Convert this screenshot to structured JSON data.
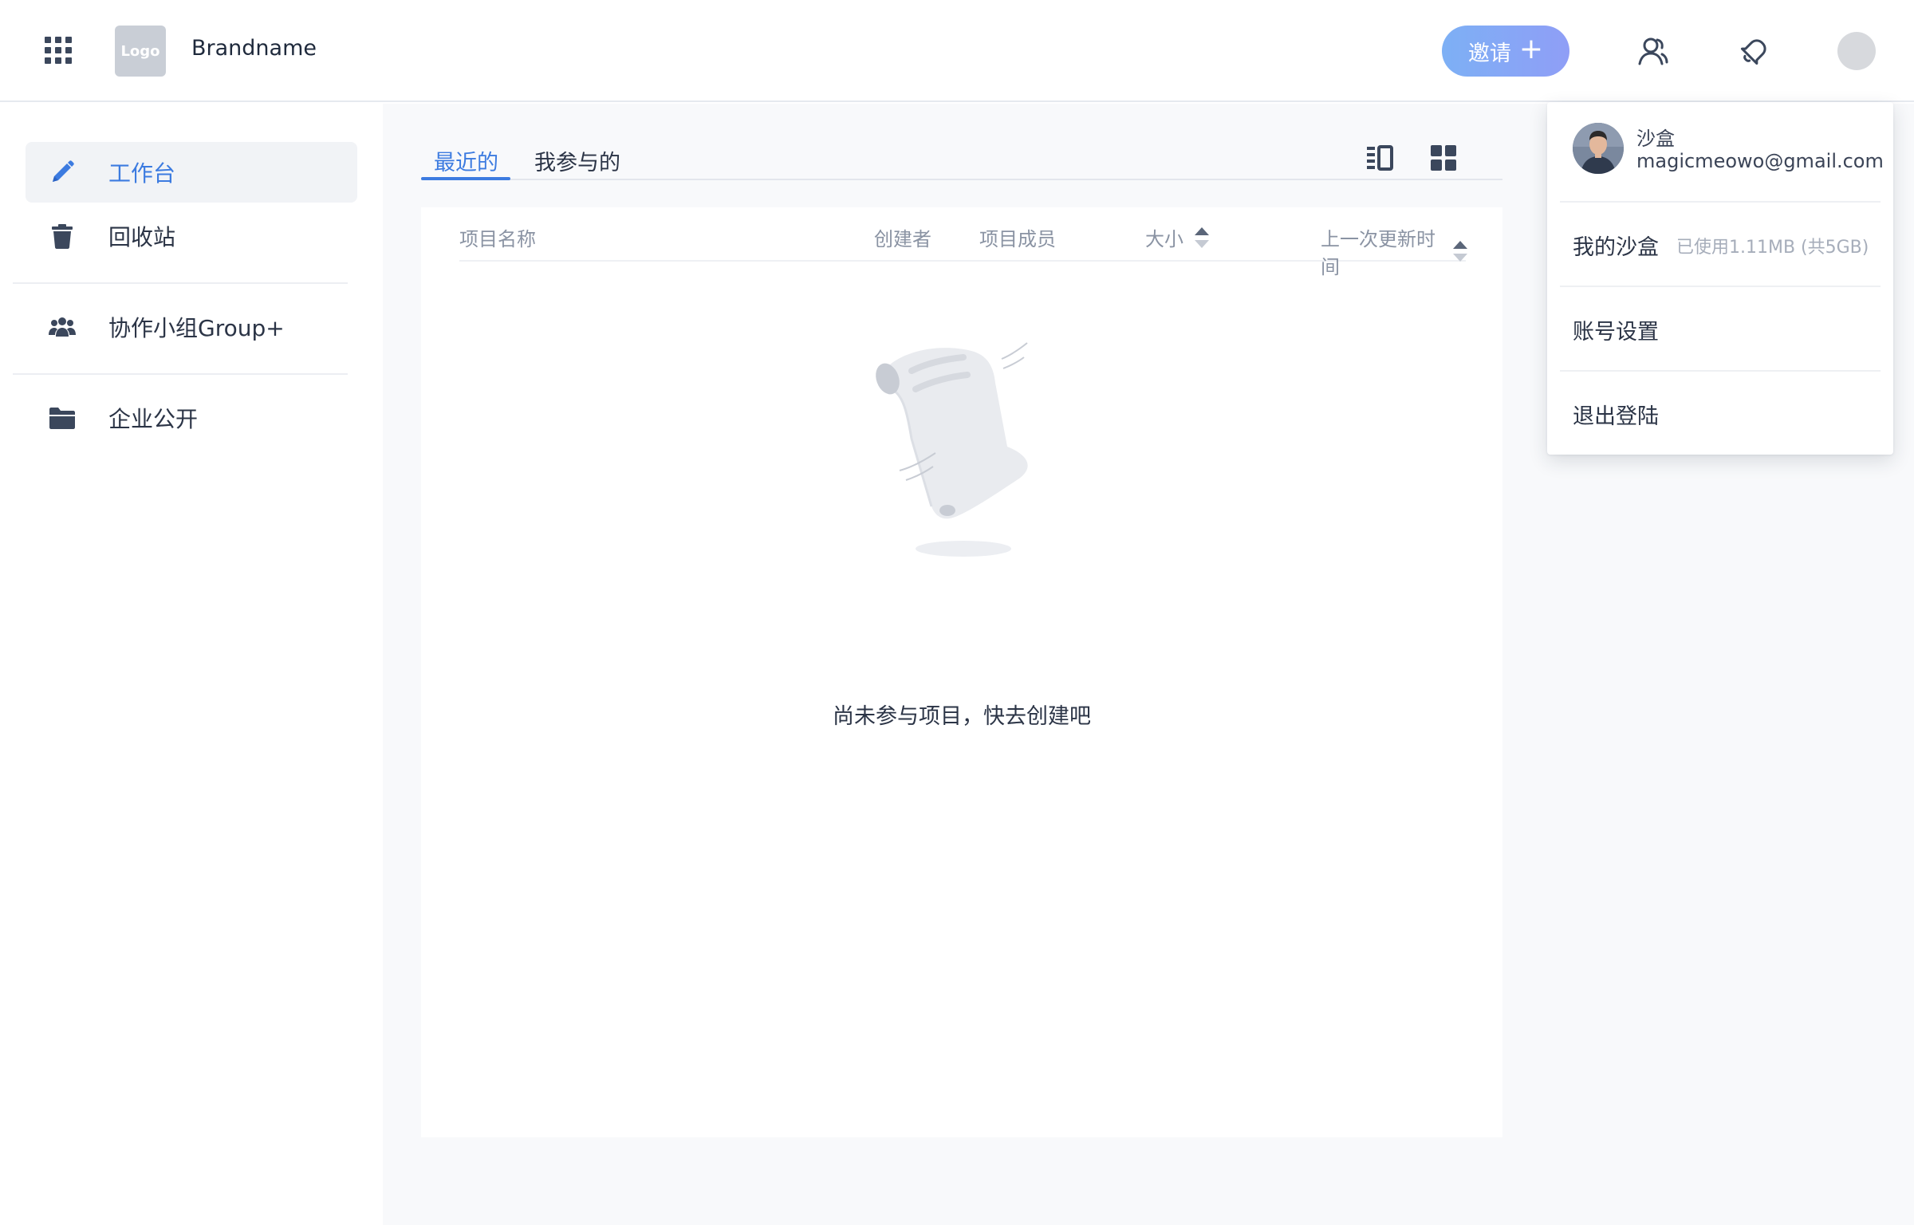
{
  "header": {
    "logo_text": "Logo",
    "brand": "Brandname",
    "invite_label": "邀请",
    "invite_plus": "+"
  },
  "sidebar": {
    "items": [
      {
        "label": "工作台",
        "icon": "pencil-icon",
        "active": true
      },
      {
        "label": "回收站",
        "icon": "trash-icon"
      },
      {
        "label": "协作小组Group+",
        "icon": "users-icon"
      },
      {
        "label": "企业公开",
        "icon": "folder-icon"
      }
    ]
  },
  "main": {
    "tabs": [
      {
        "label": "最近的",
        "active": true
      },
      {
        "label": "我参与的"
      }
    ],
    "columns": {
      "name": "项目名称",
      "creator": "创建者",
      "members": "项目成员",
      "size": "大小",
      "updated": "上一次更新时间"
    },
    "empty_text": "尚未参与项目，快去创建吧"
  },
  "dropdown": {
    "user_name": "沙盒",
    "email": "magicmeowo@gmail.com",
    "my_sandbox": "我的沙盒",
    "usage": "已使用1.11MB (共5GB)",
    "account_settings": "账号设置",
    "logout": "退出登陆"
  },
  "colors": {
    "accent": "#3c7be0",
    "invite_gradient_start": "#7db0f5",
    "invite_gradient_end": "#8f9ef6",
    "icon": "#3b475c"
  }
}
